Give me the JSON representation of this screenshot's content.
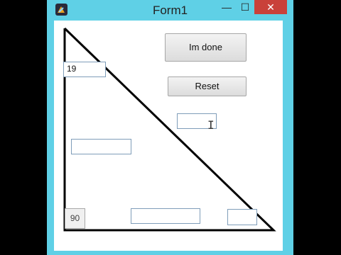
{
  "window": {
    "title": "Form1",
    "controls": {
      "minimize": "—",
      "maximize": "☐",
      "close": "✕"
    }
  },
  "buttons": {
    "done_label": "Im done",
    "reset_label": "Reset"
  },
  "fields": {
    "top_left_value": "19",
    "right_angle_value": "90",
    "hypotenuse_value": "",
    "left_mid_value": "",
    "bottom_mid_value": "",
    "bottom_right_value": ""
  },
  "colors": {
    "frame": "#5fd0e6",
    "close": "#c9413a",
    "line": "#000000"
  }
}
